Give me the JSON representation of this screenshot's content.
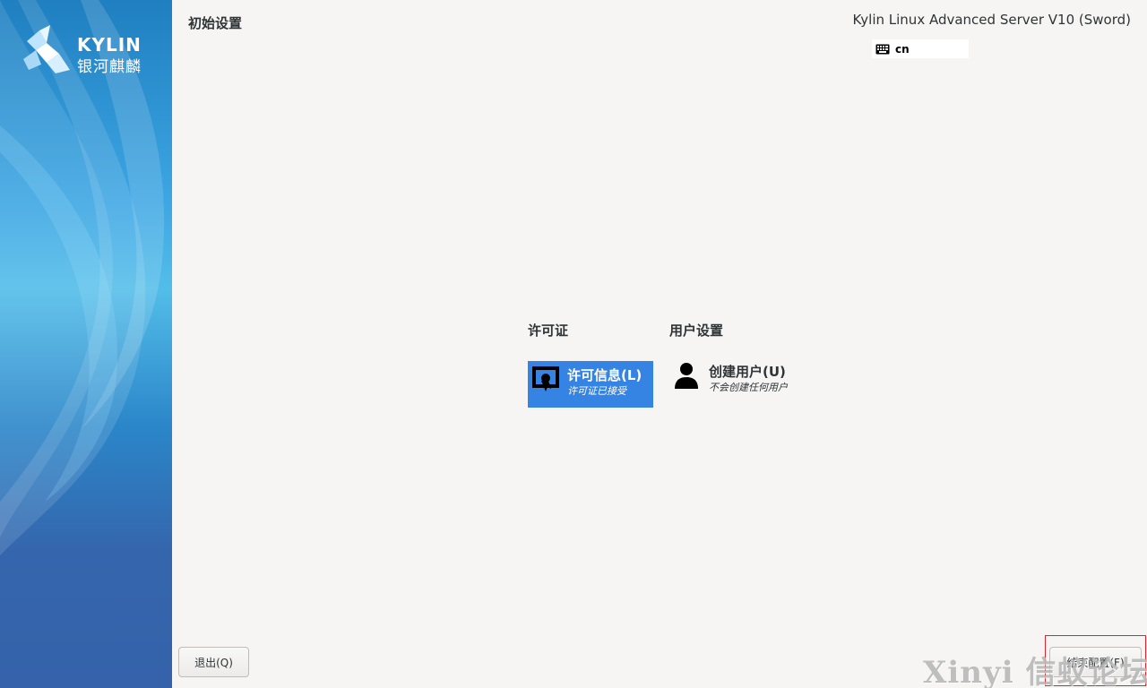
{
  "sidebar": {
    "logo_en": "KYLIN",
    "logo_cn": "银河麒麟"
  },
  "header": {
    "title": "初始设置",
    "product": "Kylin Linux Advanced Server V10 (Sword)",
    "keyboard_layout": "cn"
  },
  "sections": {
    "license": {
      "heading": "许可证",
      "spoke": {
        "title": "许可信息(L)",
        "status": "许可证已接受",
        "icon": "certificate-icon"
      }
    },
    "user_settings": {
      "heading": "用户设置",
      "spoke": {
        "title": "创建用户(U)",
        "status": "不会创建任何用户",
        "icon": "user-icon"
      }
    }
  },
  "footer": {
    "quit_label": "退出(Q)",
    "finish_label": "结束配置(F)",
    "watermark": "Xinyi 信蚁论坛"
  },
  "colors": {
    "background": "#f6f5f4",
    "selected": "#3584e4",
    "highlight": "#e0232b"
  }
}
